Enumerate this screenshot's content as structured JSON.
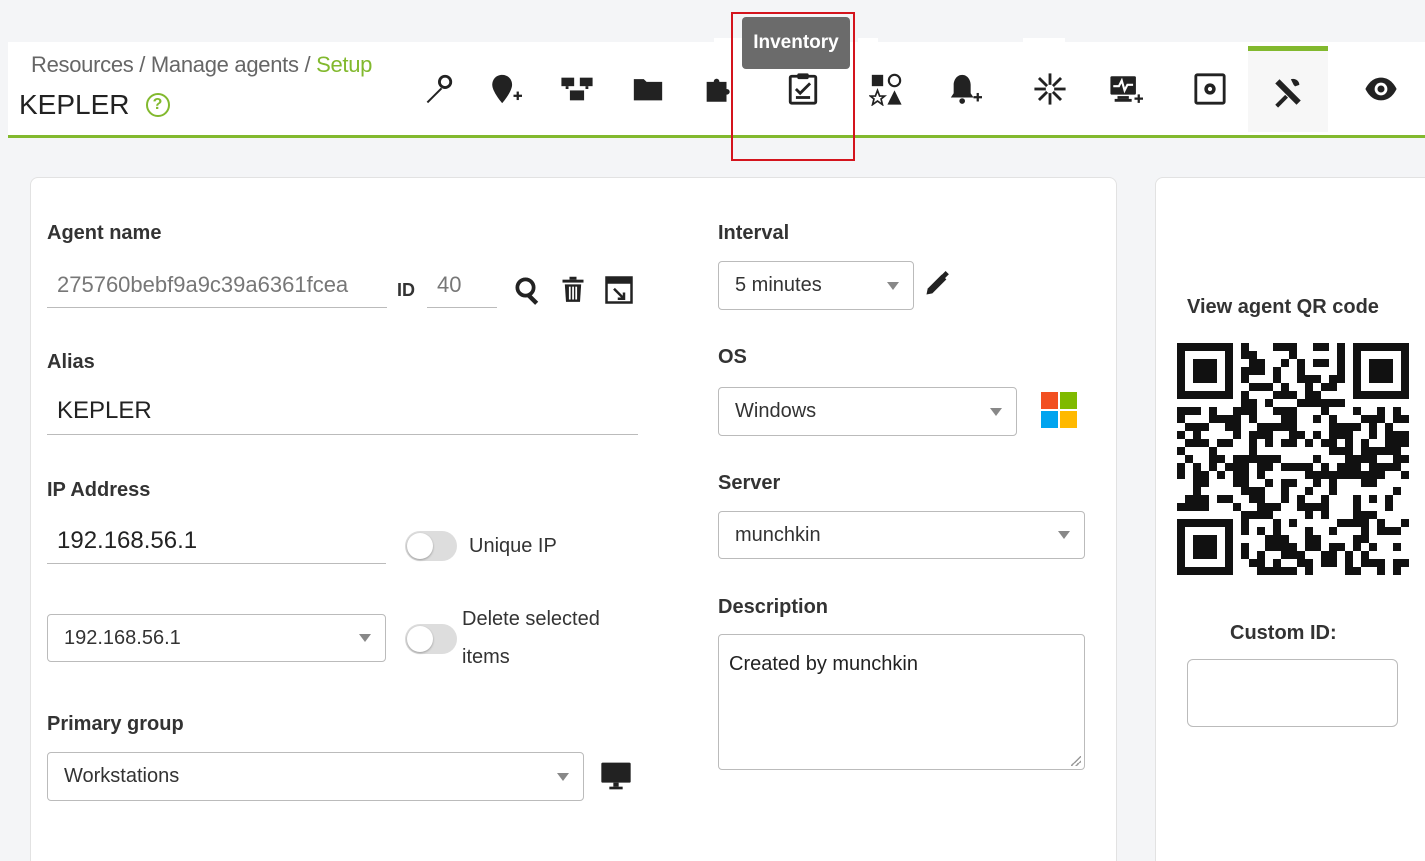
{
  "breadcrumb": {
    "parts": [
      "Resources",
      "Manage agents"
    ],
    "separator": " / ",
    "current": "Setup"
  },
  "agent": {
    "title": "KEPLER",
    "help_icon": "help-circle-icon"
  },
  "tabs": [
    {
      "name": "wrench-icon"
    },
    {
      "name": "location-pin-add-icon"
    },
    {
      "name": "network-icon"
    },
    {
      "name": "folder-icon"
    },
    {
      "name": "plugin-icon"
    },
    {
      "name": "inventory-checklist-icon"
    },
    {
      "name": "shapes-icon"
    },
    {
      "name": "alert-bell-add-icon"
    },
    {
      "name": "snowflake-icon"
    },
    {
      "name": "monitor-pulse-add-icon"
    },
    {
      "name": "settings-box-icon"
    },
    {
      "name": "tools-icon"
    },
    {
      "name": "eye-icon"
    }
  ],
  "tooltip": {
    "text": "Inventory"
  },
  "form": {
    "agent_name": {
      "label": "Agent name",
      "value": "275760bebf9a9c39a6361fcea",
      "id_label": "ID",
      "id_value": "40"
    },
    "alias": {
      "label": "Alias",
      "value": "KEPLER"
    },
    "ip": {
      "label": "IP Address",
      "value": "192.168.56.1",
      "unique_label": "Unique IP"
    },
    "ip_select": {
      "value": "192.168.56.1",
      "delete_label_1": "Delete selected",
      "delete_label_2": "items"
    },
    "primary_group": {
      "label": "Primary group",
      "value": "Workstations"
    },
    "interval": {
      "label": "Interval",
      "value": "5 minutes"
    },
    "os": {
      "label": "OS",
      "value": "Windows"
    },
    "server": {
      "label": "Server",
      "value": "munchkin"
    },
    "description": {
      "label": "Description",
      "value": "Created by munchkin"
    }
  },
  "side": {
    "qr_title": "View agent QR code",
    "custom_id_label": "Custom ID:",
    "custom_id_value": ""
  },
  "colors": {
    "accent": "#82b92e",
    "highlight": "#d4141d",
    "tooltip_bg": "#6b6b6b"
  }
}
